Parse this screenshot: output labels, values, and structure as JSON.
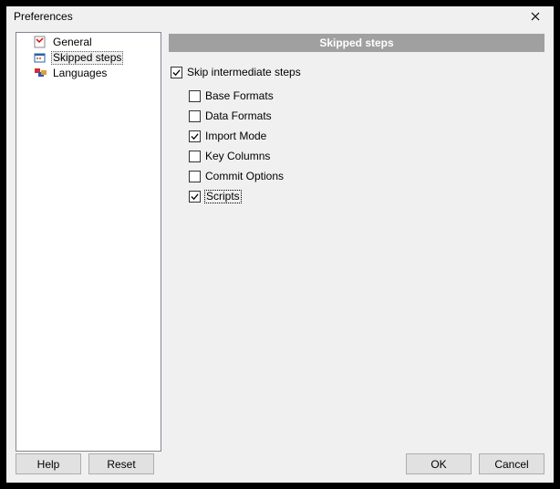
{
  "window": {
    "title": "Preferences"
  },
  "tree": {
    "items": [
      {
        "label": "General",
        "icon": "general-icon",
        "selected": false
      },
      {
        "label": "Skipped steps",
        "icon": "skipped-icon",
        "selected": true
      },
      {
        "label": "Languages",
        "icon": "languages-icon",
        "selected": false
      }
    ]
  },
  "panel": {
    "header": "Skipped steps",
    "master": {
      "label": "Skip intermediate steps",
      "checked": true
    },
    "options": [
      {
        "label": "Base Formats",
        "checked": false,
        "focused": false
      },
      {
        "label": "Data Formats",
        "checked": false,
        "focused": false
      },
      {
        "label": "Import Mode",
        "checked": true,
        "focused": false
      },
      {
        "label": "Key Columns",
        "checked": false,
        "focused": false
      },
      {
        "label": "Commit Options",
        "checked": false,
        "focused": false
      },
      {
        "label": "Scripts",
        "checked": true,
        "focused": true
      }
    ]
  },
  "buttons": {
    "help": "Help",
    "reset": "Reset",
    "ok": "OK",
    "cancel": "Cancel"
  }
}
